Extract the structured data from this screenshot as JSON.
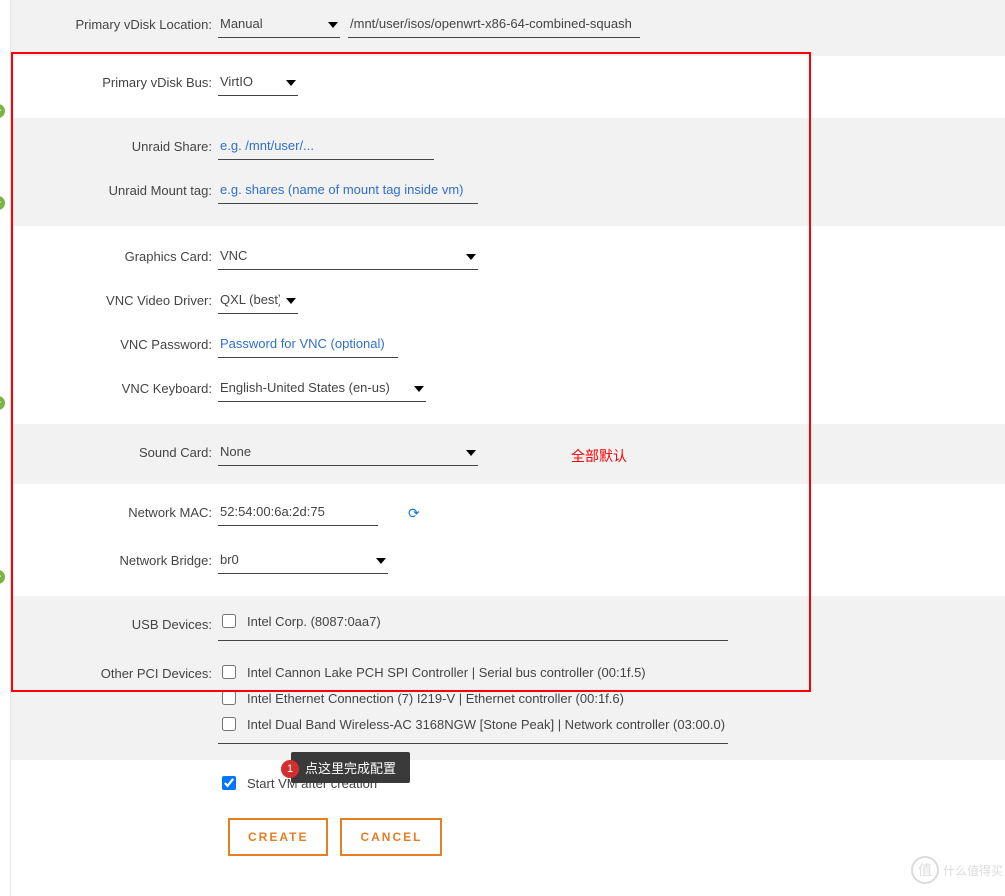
{
  "rows": {
    "vdisk_loc": {
      "label": "Primary vDisk Location:",
      "select": "Manual",
      "path": "/mnt/user/isos/openwrt-x86-64-combined-squash"
    },
    "vdisk_bus": {
      "label": "Primary vDisk Bus:",
      "select": "VirtIO"
    },
    "unraid_share": {
      "label": "Unraid Share:",
      "placeholder": "e.g. /mnt/user/..."
    },
    "unraid_mount": {
      "label": "Unraid Mount tag:",
      "placeholder": "e.g. shares (name of mount tag inside vm)"
    },
    "graphics": {
      "label": "Graphics Card:",
      "select": "VNC"
    },
    "vnc_driver": {
      "label": "VNC Video Driver:",
      "select": "QXL (best)"
    },
    "vnc_pass": {
      "label": "VNC Password:",
      "placeholder": "Password for VNC (optional)"
    },
    "vnc_kb": {
      "label": "VNC Keyboard:",
      "select": "English-United States (en-us)"
    },
    "sound": {
      "label": "Sound Card:",
      "select": "None"
    },
    "net_mac": {
      "label": "Network MAC:",
      "value": "52:54:00:6a:2d:75"
    },
    "net_bridge": {
      "label": "Network Bridge:",
      "select": "br0"
    },
    "usb": {
      "label": "USB Devices:",
      "items": [
        "Intel Corp. (8087:0aa7)"
      ]
    },
    "pci": {
      "label": "Other PCI Devices:",
      "items": [
        "Intel Cannon Lake PCH SPI Controller | Serial bus controller (00:1f.5)",
        "Intel Ethernet Connection (7) I219-V | Ethernet controller (00:1f.6)",
        "Intel Dual Band Wireless-AC 3168NGW [Stone Peak] | Network controller (03:00.0)"
      ]
    },
    "start_vm": {
      "label": "Start VM after creation",
      "checked": true
    }
  },
  "buttons": {
    "create": "CREATE",
    "cancel": "CANCEL"
  },
  "annotation": "全部默认",
  "tooltip": {
    "num": "1",
    "text": "点这里完成配置"
  },
  "watermark": "什么值得买"
}
